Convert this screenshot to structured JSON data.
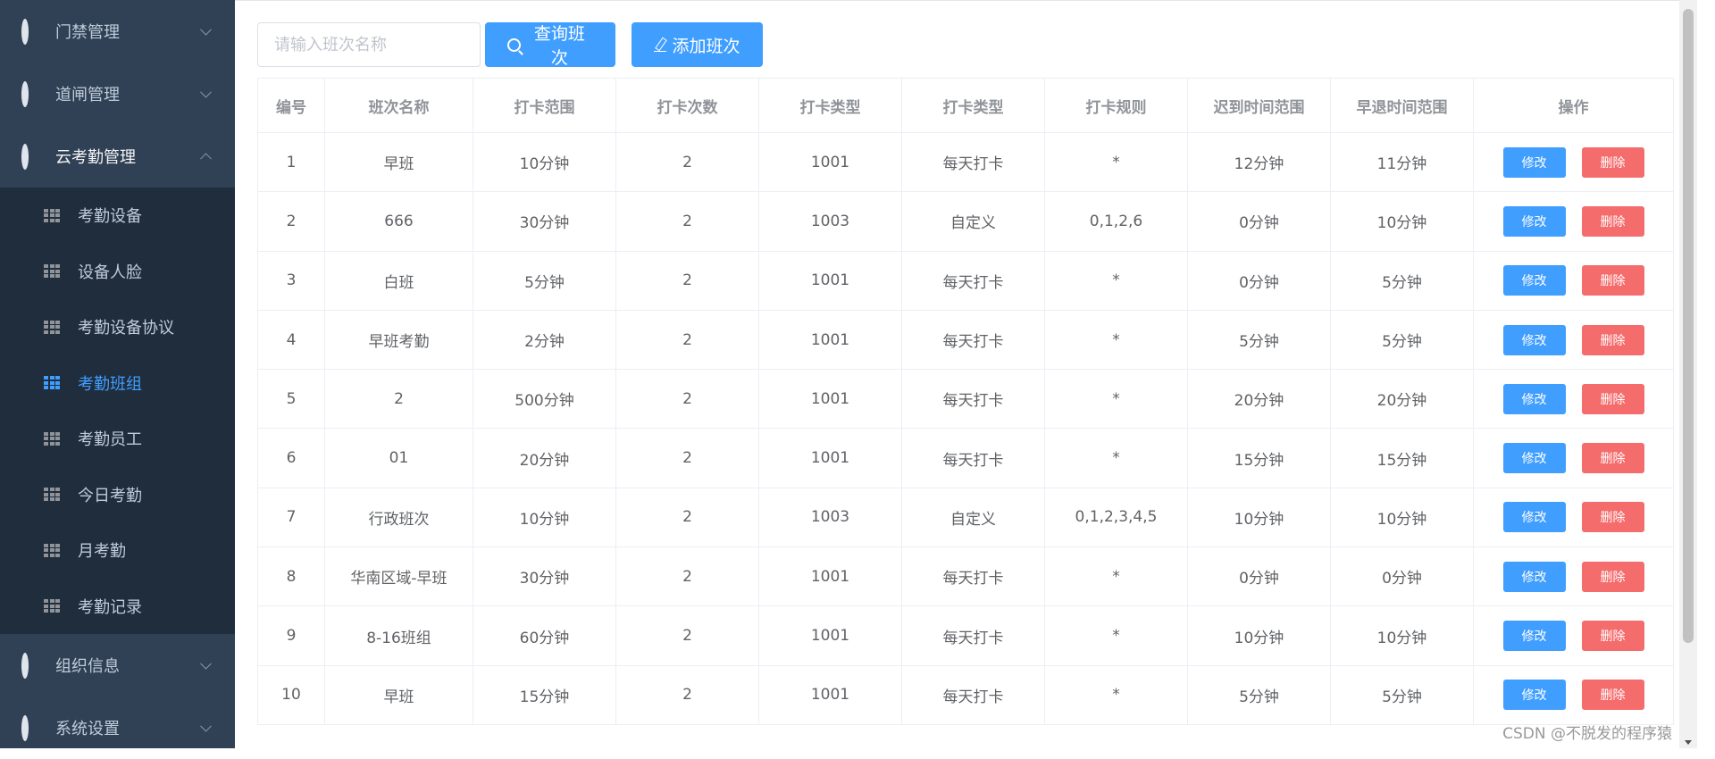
{
  "sidebar": {
    "menus_top": [
      {
        "label": "门禁管理",
        "icon": "gear-icon",
        "expanded": false
      },
      {
        "label": "道闸管理",
        "icon": "gear-icon",
        "expanded": false
      },
      {
        "label": "云考勤管理",
        "icon": "gear-icon",
        "expanded": true
      }
    ],
    "submenu": [
      {
        "label": "考勤设备",
        "active": false
      },
      {
        "label": "设备人脸",
        "active": false
      },
      {
        "label": "考勤设备协议",
        "active": false
      },
      {
        "label": "考勤班组",
        "active": true
      },
      {
        "label": "考勤员工",
        "active": false
      },
      {
        "label": "今日考勤",
        "active": false
      },
      {
        "label": "月考勤",
        "active": false
      },
      {
        "label": "考勤记录",
        "active": false
      }
    ],
    "menus_bottom": [
      {
        "label": "组织信息",
        "icon": "gear-icon",
        "expanded": false
      },
      {
        "label": "系统设置",
        "icon": "gear-icon",
        "expanded": false
      }
    ]
  },
  "toolbar": {
    "search_placeholder": "请输入班次名称",
    "query_label": "查询班次",
    "add_label": "添加班次"
  },
  "table": {
    "columns": [
      "编号",
      "班次名称",
      "打卡范围",
      "打卡次数",
      "打卡类型",
      "打卡类型",
      "打卡规则",
      "迟到时间范围",
      "早退时间范围",
      "操作"
    ],
    "rows": [
      [
        "1",
        "早班",
        "10分钟",
        "2",
        "1001",
        "每天打卡",
        "*",
        "12分钟",
        "11分钟"
      ],
      [
        "2",
        "666",
        "30分钟",
        "2",
        "1003",
        "自定义",
        "0,1,2,6",
        "0分钟",
        "10分钟"
      ],
      [
        "3",
        "白班",
        "5分钟",
        "2",
        "1001",
        "每天打卡",
        "*",
        "0分钟",
        "5分钟"
      ],
      [
        "4",
        "早班考勤",
        "2分钟",
        "2",
        "1001",
        "每天打卡",
        "*",
        "5分钟",
        "5分钟"
      ],
      [
        "5",
        "2",
        "500分钟",
        "2",
        "1001",
        "每天打卡",
        "*",
        "20分钟",
        "20分钟"
      ],
      [
        "6",
        "01",
        "20分钟",
        "2",
        "1001",
        "每天打卡",
        "*",
        "15分钟",
        "15分钟"
      ],
      [
        "7",
        "行政班次",
        "10分钟",
        "2",
        "1003",
        "自定义",
        "0,1,2,3,4,5",
        "10分钟",
        "10分钟"
      ],
      [
        "8",
        "华南区域-早班",
        "30分钟",
        "2",
        "1001",
        "每天打卡",
        "*",
        "0分钟",
        "0分钟"
      ],
      [
        "9",
        "8-16班组",
        "60分钟",
        "2",
        "1001",
        "每天打卡",
        "*",
        "10分钟",
        "10分钟"
      ],
      [
        "10",
        "早班",
        "15分钟",
        "2",
        "1001",
        "每天打卡",
        "*",
        "5分钟",
        "5分钟"
      ]
    ],
    "edit_label": "修改",
    "delete_label": "删除"
  },
  "watermark": "CSDN @不脱发的程序猿",
  "colors": {
    "sidebar_bg": "#304156",
    "submenu_bg": "#1f2d3d",
    "primary": "#409eff",
    "danger": "#f56c6c"
  }
}
